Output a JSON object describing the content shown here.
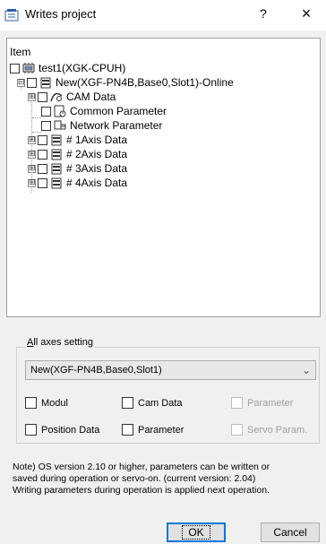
{
  "window": {
    "title": "Writes project",
    "help_label": "?",
    "close_label": "×"
  },
  "tree": {
    "header": "Item",
    "root": {
      "label": "test1(XGK-CPUH)",
      "icon": "plc-cpu-icon"
    },
    "module": {
      "label": "New(XGF-PN4B,Base0,Slot1)-Online",
      "expander": "⊟",
      "icon": "module-icon"
    },
    "children": [
      {
        "label": "CAM Data",
        "icon": "cam-data-icon",
        "expander": "⊞"
      },
      {
        "label": "Common Parameter",
        "icon": "common-parameter-icon",
        "expander": ""
      },
      {
        "label": "Network Parameter",
        "icon": "network-parameter-icon",
        "expander": ""
      },
      {
        "label": "# 1Axis Data",
        "icon": "axis-data-icon",
        "expander": "⊞"
      },
      {
        "label": "# 2Axis Data",
        "icon": "axis-data-icon",
        "expander": "⊞"
      },
      {
        "label": "# 3Axis Data",
        "icon": "axis-data-icon",
        "expander": "⊞"
      },
      {
        "label": "# 4Axis Data",
        "icon": "axis-data-icon",
        "expander": "⊞"
      }
    ]
  },
  "axes_setting": {
    "legend_underlined": "A",
    "legend_rest": "ll axes setting",
    "selected_module": "New(XGF-PN4B,Base0,Slot1)",
    "checkboxes": {
      "modul": "Modul",
      "cam_data": "Cam Data",
      "parameter_disabled": "Parameter",
      "position_data": "Position Data",
      "parameter": "Parameter",
      "servo_param": "Servo Param."
    }
  },
  "note": {
    "line1": "Note) OS version 2.10 or higher, parameters can be written or",
    "line2": "saved during operation or servo-on. (current version: 2.04)",
    "line3": "Writing parameters during operation is applied next operation."
  },
  "buttons": {
    "ok": "OK",
    "cancel": "Cancel"
  },
  "colors": {
    "accent": "#0078d7",
    "panel_bg": "#f0f0f0",
    "disabled_text": "#a0a0a0"
  }
}
